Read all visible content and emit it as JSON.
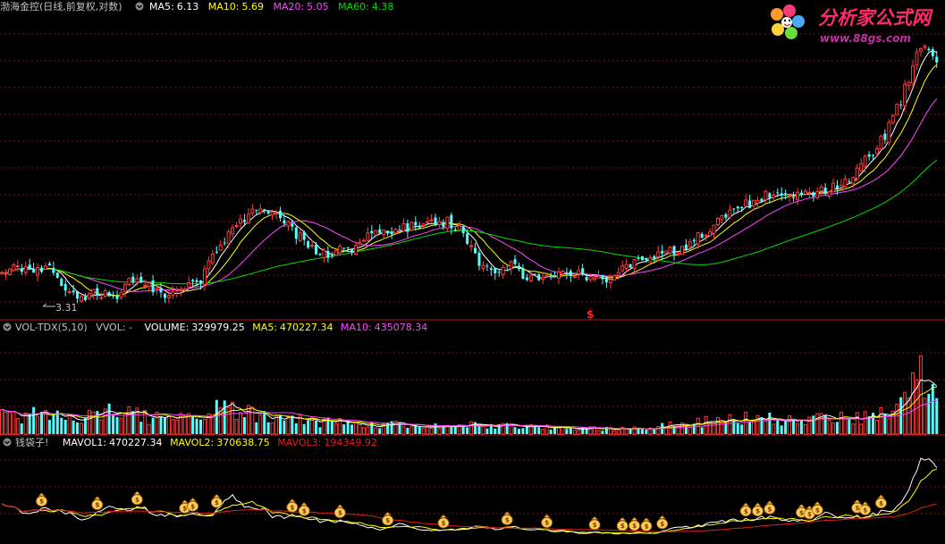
{
  "colors": {
    "background": "#000000",
    "grid": "#7a1010",
    "separator": "#b01818",
    "up": "#ff3a3a",
    "down": "#54ffff",
    "label_gray": "#c0c0c0",
    "ma5": "#ffffff",
    "ma10": "#ffff00",
    "ma20": "#ff44ff",
    "ma60": "#00dd00",
    "mavol3": "#e02020",
    "bag_fill": "#ffcc55",
    "bag_stroke": "#a06010",
    "logo_text": "#ff2a6a",
    "logo_url": "#c030a0"
  },
  "price_panel": {
    "title": "渤海金控(日线,前复权,对数)",
    "indicators": [
      {
        "label": "MA5:",
        "value": "6.13",
        "color": "#ffffff"
      },
      {
        "label": "MA10:",
        "value": "5.69",
        "color": "#ffff00"
      },
      {
        "label": "MA20:",
        "value": "5.05",
        "color": "#ff44ff"
      },
      {
        "label": "MA60:",
        "value": "4.38",
        "color": "#00dd00"
      }
    ],
    "low_marker": "3.31",
    "signal_marker": "$"
  },
  "volume_panel": {
    "title": "VOL-TDX(5,10)",
    "vvol": "VVOL: -",
    "items": [
      {
        "label": "VOLUME:",
        "value": "329979.25",
        "color": "#ffffff"
      },
      {
        "label": "MA5:",
        "value": "470227.34",
        "color": "#ffff00"
      },
      {
        "label": "MA10:",
        "value": "435078.34",
        "color": "#ff44ff"
      }
    ]
  },
  "bag_panel": {
    "title": "钱袋子!",
    "items": [
      {
        "label": "MAVOL1:",
        "value": "470227.34",
        "color": "#ffffff"
      },
      {
        "label": "MAVOL2:",
        "value": "370638.75",
        "color": "#ffff00"
      },
      {
        "label": "MAVOL3:",
        "value": "194349.92",
        "color": "#e02020"
      }
    ],
    "bag_symbol": "$"
  },
  "logo": {
    "name": "分析家公式网",
    "url": "www.88gs.com"
  },
  "chart_data": {
    "type": "candlestick",
    "scale": "log",
    "low_annotation": 3.31,
    "bars": 200,
    "anchors_close": [
      [
        0,
        3.9
      ],
      [
        8,
        3.85
      ],
      [
        12,
        3.95
      ],
      [
        16,
        3.6
      ],
      [
        20,
        3.4
      ],
      [
        24,
        3.5
      ],
      [
        28,
        3.4
      ],
      [
        32,
        3.7
      ],
      [
        36,
        3.65
      ],
      [
        40,
        3.45
      ],
      [
        44,
        3.6
      ],
      [
        50,
        3.7
      ],
      [
        56,
        4.5
      ],
      [
        62,
        5.0
      ],
      [
        66,
        5.2
      ],
      [
        70,
        5.0
      ],
      [
        74,
        4.6
      ],
      [
        78,
        4.3
      ],
      [
        82,
        4.2
      ],
      [
        88,
        4.3
      ],
      [
        94,
        4.6
      ],
      [
        100,
        4.7
      ],
      [
        106,
        4.8
      ],
      [
        112,
        4.85
      ],
      [
        116,
        4.6
      ],
      [
        120,
        4.0
      ],
      [
        124,
        3.9
      ],
      [
        128,
        4.0
      ],
      [
        132,
        3.75
      ],
      [
        136,
        3.7
      ],
      [
        140,
        3.85
      ],
      [
        146,
        3.8
      ],
      [
        152,
        3.75
      ],
      [
        156,
        3.9
      ],
      [
        160,
        4.0
      ],
      [
        166,
        4.2
      ],
      [
        172,
        4.35
      ],
      [
        178,
        4.7
      ],
      [
        184,
        5.1
      ],
      [
        190,
        5.4
      ],
      [
        196,
        5.6
      ],
      [
        200,
        5.5
      ],
      [
        206,
        5.6
      ],
      [
        210,
        5.7
      ],
      [
        214,
        6.1
      ],
      [
        218,
        6.6
      ],
      [
        222,
        7.2
      ],
      [
        226,
        8.5
      ],
      [
        230,
        10.5
      ],
      [
        232,
        11.0
      ],
      [
        235,
        10.2
      ]
    ],
    "volume_anchors": [
      [
        0,
        0.18
      ],
      [
        10,
        0.2
      ],
      [
        20,
        0.14
      ],
      [
        24,
        0.22
      ],
      [
        30,
        0.2
      ],
      [
        40,
        0.16
      ],
      [
        48,
        0.15
      ],
      [
        52,
        0.26
      ],
      [
        60,
        0.22
      ],
      [
        70,
        0.15
      ],
      [
        80,
        0.12
      ],
      [
        90,
        0.1
      ],
      [
        100,
        0.09
      ],
      [
        110,
        0.08
      ],
      [
        120,
        0.1
      ],
      [
        130,
        0.07
      ],
      [
        140,
        0.06
      ],
      [
        150,
        0.05
      ],
      [
        160,
        0.06
      ],
      [
        170,
        0.09
      ],
      [
        180,
        0.14
      ],
      [
        190,
        0.16
      ],
      [
        200,
        0.13
      ],
      [
        210,
        0.16
      ],
      [
        220,
        0.17
      ],
      [
        225,
        0.24
      ],
      [
        228,
        0.5
      ],
      [
        230,
        0.62
      ],
      [
        232,
        0.48
      ],
      [
        235,
        0.42
      ]
    ]
  }
}
